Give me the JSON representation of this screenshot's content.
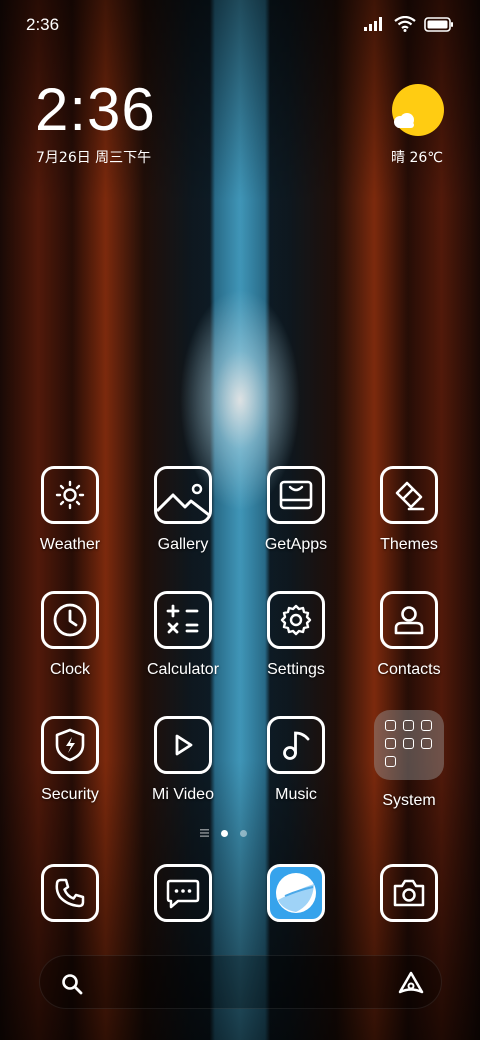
{
  "status_bar": {
    "time": "2:36"
  },
  "lockclock": {
    "time": "2:36",
    "date": "7月26日 周三下午"
  },
  "weather": {
    "text": "晴 26℃"
  },
  "apps": [
    {
      "label": "Weather",
      "icon": "sun-icon"
    },
    {
      "label": "Gallery",
      "icon": "image-icon"
    },
    {
      "label": "GetApps",
      "icon": "store-icon"
    },
    {
      "label": "Themes",
      "icon": "brush-icon"
    },
    {
      "label": "Clock",
      "icon": "clock-icon"
    },
    {
      "label": "Calculator",
      "icon": "calculator-icon"
    },
    {
      "label": "Settings",
      "icon": "gear-icon"
    },
    {
      "label": "Contacts",
      "icon": "person-icon"
    },
    {
      "label": "Security",
      "icon": "shield-bolt-icon"
    },
    {
      "label": "Mi Video",
      "icon": "play-icon"
    },
    {
      "label": "Music",
      "icon": "music-note-icon"
    },
    {
      "label": "System",
      "icon": "folder-icon"
    }
  ],
  "page_indicator": {
    "pages": 2,
    "current": 1
  },
  "dock": [
    {
      "icon": "phone-icon"
    },
    {
      "icon": "messages-icon"
    },
    {
      "icon": "browser-icon"
    },
    {
      "icon": "camera-icon"
    }
  ],
  "colors": {
    "sun": "#ffcc12",
    "browser_bg": "#36a3ec"
  }
}
